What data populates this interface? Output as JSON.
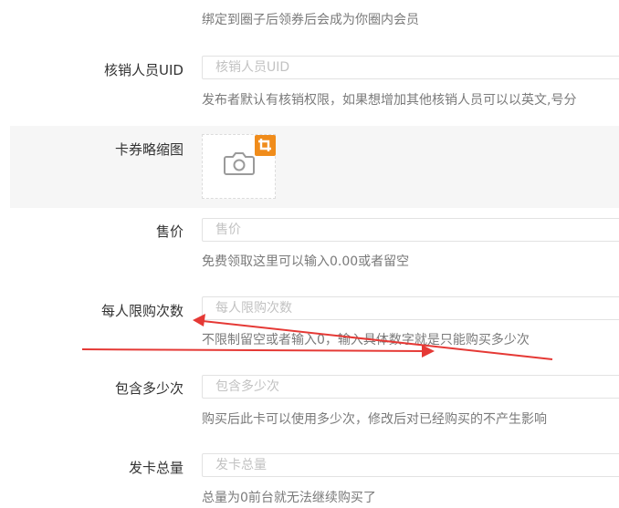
{
  "form": {
    "circle_hint": "绑定到圈子后领券后会成为你圈内会员",
    "verifier": {
      "label": "核销人员UID",
      "placeholder": "核销人员UID",
      "hint": "发布者默认有核销权限，如果想增加其他核销人员可以以英文,号分"
    },
    "thumbnail": {
      "label": "卡券略缩图"
    },
    "price": {
      "label": "售价",
      "placeholder": "售价",
      "hint": "免费领取这里可以输入0.00或者留空"
    },
    "limit": {
      "label": "每人限购次数",
      "placeholder": "每人限购次数",
      "hint": "不限制留空或者输入0，输入具体数字就是只能购买多少次"
    },
    "uses": {
      "label": "包含多少次",
      "placeholder": "包含多少次",
      "hint": "购买后此卡可以使用多少次，修改后对已经购买的不产生影响"
    },
    "total": {
      "label": "发卡总量",
      "placeholder": "发卡总量",
      "hint": "总量为0前台就无法继续购买了"
    }
  },
  "colors": {
    "annotation_red": "#e53935",
    "crop_badge": "#f08c1b"
  },
  "icons": {
    "upload": "camera-icon",
    "crop": "crop-icon"
  }
}
